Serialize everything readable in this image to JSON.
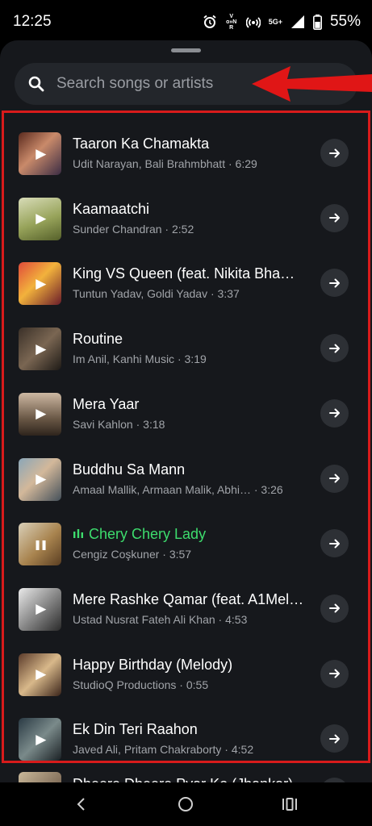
{
  "status_bar": {
    "time": "12:25",
    "volte_label": "Vo»NR",
    "network_label": "5G+",
    "battery_percent": "55%"
  },
  "search": {
    "placeholder": "Search songs or artists"
  },
  "colors": {
    "accent_playing": "#3ddc6d",
    "highlight_border": "#d81b1b",
    "sheet_background": "#16181c"
  },
  "songs": [
    {
      "title": "Taaron Ka Chamakta",
      "artist": "Udit Narayan, Bali Brahmbhatt",
      "duration": "6:29",
      "state": "paused"
    },
    {
      "title": "Kaamaatchi",
      "artist": "Sunder Chandran",
      "duration": "2:52",
      "state": "paused"
    },
    {
      "title": "King VS Queen (feat. Nikita Bha…",
      "artist": "Tuntun Yadav, Goldi Yadav",
      "duration": "3:37",
      "state": "paused"
    },
    {
      "title": "Routine",
      "artist": "Im Anil, Kanhi Music",
      "duration": "3:19",
      "state": "paused"
    },
    {
      "title": "Mera Yaar",
      "artist": "Savi Kahlon",
      "duration": "3:18",
      "state": "paused"
    },
    {
      "title": "Buddhu Sa Mann",
      "artist": "Amaal Mallik, Armaan Malik, Abhi…",
      "duration": "3:26",
      "state": "paused"
    },
    {
      "title": "Chery Chery Lady",
      "artist": "Cengiz Coşkuner",
      "duration": "3:57",
      "state": "playing"
    },
    {
      "title": "Mere Rashke Qamar (feat. A1Mel…",
      "artist": "Ustad Nusrat Fateh Ali Khan",
      "duration": "4:53",
      "state": "paused"
    },
    {
      "title": "Happy Birthday (Melody)",
      "artist": "StudioQ Productions",
      "duration": "0:55",
      "state": "paused"
    },
    {
      "title": "Ek Din Teri Raahon",
      "artist": "Javed Ali, Pritam Chakraborty",
      "duration": "4:52",
      "state": "paused"
    }
  ],
  "peek_song": {
    "title": "Dheere Dheere Pyar Ko (Jhankar)"
  },
  "icons": {
    "play": "▶",
    "pause": "❚❚"
  }
}
